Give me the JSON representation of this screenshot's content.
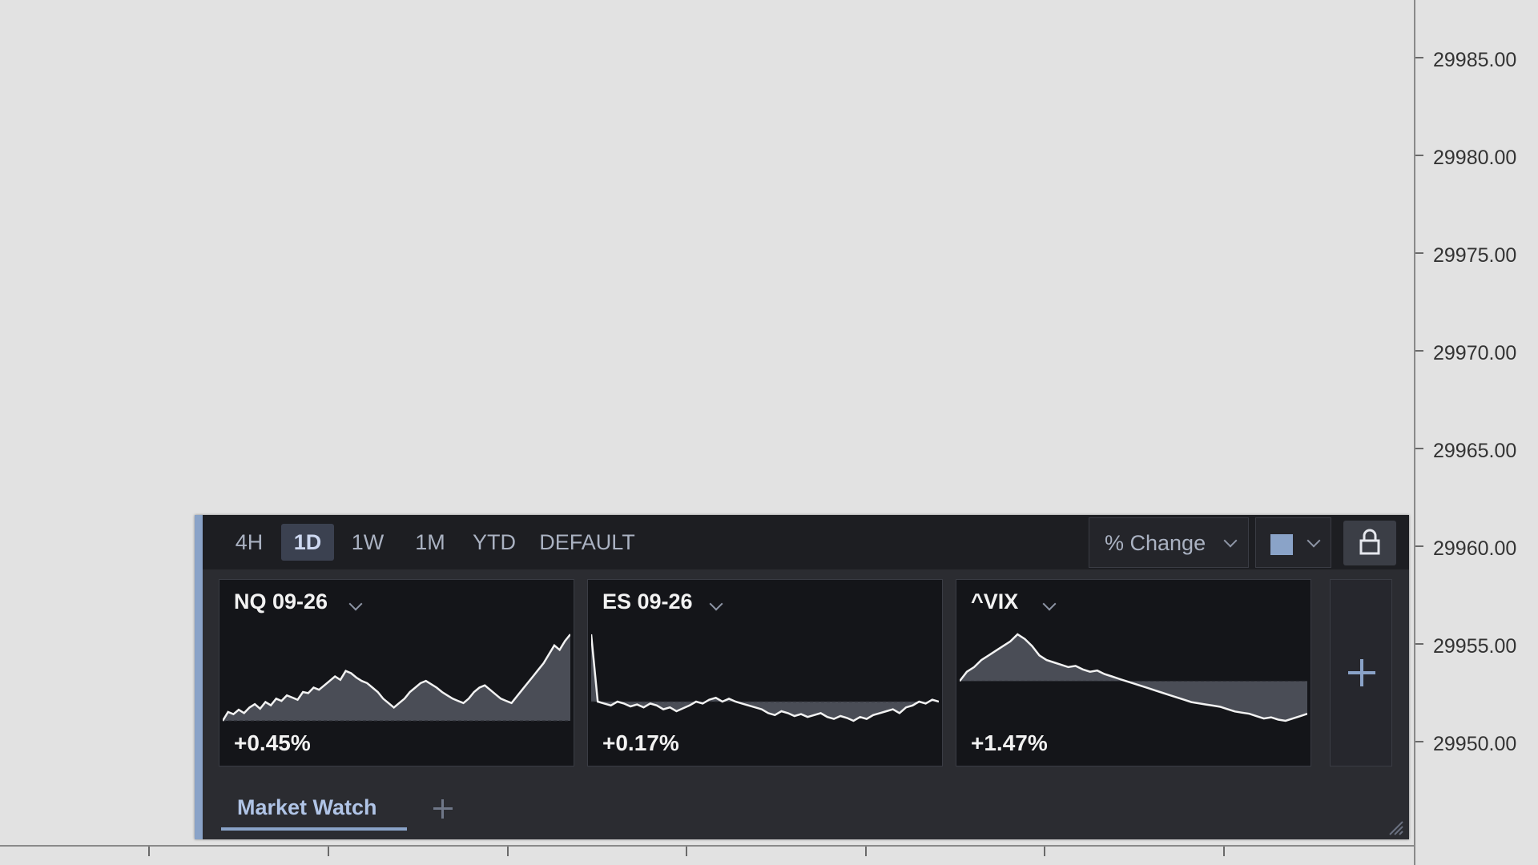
{
  "price_axis": {
    "labels": [
      "29985.00",
      "29980.00",
      "29975.00",
      "29970.00",
      "29965.00",
      "29960.00",
      "29955.00",
      "29950.00"
    ]
  },
  "toolbar": {
    "timeframes": [
      "4H",
      "1D",
      "1W",
      "1M",
      "YTD",
      "DEFAULT"
    ],
    "active_timeframe": "1D",
    "metric": "% Change",
    "color_swatch": "#8aa3c8",
    "lock_icon": "lock-icon"
  },
  "cards": [
    {
      "symbol": "NQ 09-26",
      "change": "+0.45%",
      "sparkline": [
        10,
        18,
        16,
        20,
        17,
        22,
        25,
        21,
        27,
        24,
        30,
        28,
        33,
        31,
        29,
        36,
        35,
        40,
        38,
        42,
        46,
        50,
        47,
        55,
        53,
        49,
        46,
        44,
        40,
        36,
        30,
        26,
        22,
        26,
        30,
        36,
        40,
        44,
        46,
        43,
        40,
        36,
        33,
        30,
        28,
        26,
        30,
        36,
        40,
        42,
        38,
        34,
        30,
        28,
        26,
        32,
        38,
        44,
        50,
        56,
        62,
        70,
        78,
        74,
        82,
        88
      ]
    },
    {
      "symbol": "ES 09-26",
      "change": "+0.17%",
      "sparkline": [
        100,
        30,
        28,
        26,
        30,
        28,
        25,
        27,
        24,
        28,
        26,
        22,
        24,
        20,
        23,
        26,
        30,
        28,
        32,
        34,
        30,
        33,
        30,
        28,
        26,
        24,
        22,
        18,
        16,
        20,
        18,
        15,
        17,
        14,
        16,
        18,
        14,
        12,
        15,
        13,
        10,
        14,
        12,
        16,
        18,
        20,
        22,
        18,
        24,
        26,
        30,
        28,
        32,
        30
      ]
    },
    {
      "symbol": "^VIX",
      "change": "+1.47%",
      "sparkline": [
        40,
        48,
        52,
        58,
        62,
        66,
        70,
        74,
        80,
        76,
        70,
        62,
        58,
        56,
        54,
        52,
        53,
        50,
        48,
        49,
        46,
        44,
        42,
        40,
        38,
        36,
        34,
        32,
        30,
        28,
        26,
        24,
        22,
        21,
        20,
        19,
        18,
        16,
        14,
        13,
        12,
        10,
        8,
        9,
        7,
        6,
        8,
        10,
        12
      ]
    }
  ],
  "tabs": {
    "active_tab": "Market Watch"
  }
}
